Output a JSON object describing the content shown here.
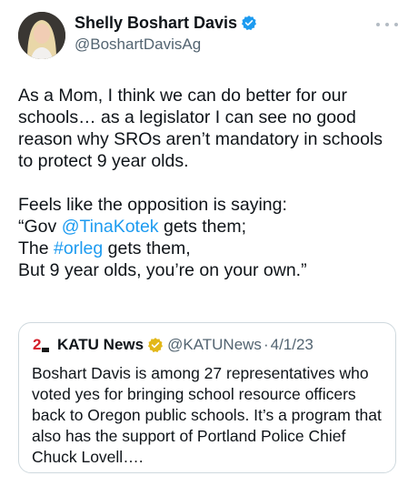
{
  "author": {
    "display_name": "Shelly Boshart Davis",
    "handle": "@BoshartDavisAg",
    "verified_icon": "verified-badge-icon",
    "verified_color": "#1d9bf0"
  },
  "tweet": {
    "p1": [
      "As a Mom, I think we can do better for our",
      "schools… as a legislator I can see no good",
      "reason why SROs aren’t mandatory in schools",
      "to protect 9 year olds."
    ],
    "p2_line1": "Feels like the opposition is saying:",
    "p2_line2_pre": "“Gov ",
    "p2_line2_mention": "@TinaKotek",
    "p2_line2_post": " gets them;",
    "p2_line3_pre": "The ",
    "p2_line3_hashtag": "#orleg",
    "p2_line3_post": " gets them,",
    "p2_line4": "But 9 year olds, you’re on your own.”",
    "link_color": "#1d9bf0"
  },
  "quote": {
    "logo_icon": "katu-2-logo-icon",
    "name": "KATU News",
    "verified_icon": "gold-verified-badge-icon",
    "verified_color": "#e2b719",
    "handle": "@KATUNews",
    "separator": "·",
    "date": "4/1/23",
    "lines": [
      "Boshart Davis is among 27 representatives who",
      "voted yes for bringing school resource officers",
      "back to Oregon public schools. It’s a program that",
      "also has the support of Portland Police Chief",
      "Chuck Lovell…."
    ]
  },
  "more_icon": "more-options-icon"
}
